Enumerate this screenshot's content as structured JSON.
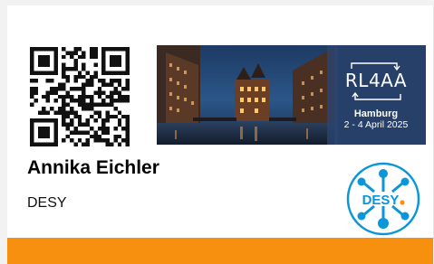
{
  "badge": {
    "name": "Annika Eichler",
    "organization": "DESY",
    "qr_code": "qr-code",
    "colors": {
      "stripe": "#f7900e",
      "desy_blue": "#0a96d8",
      "desy_dot": "#f7900e",
      "banner_sky": "#24466e"
    }
  },
  "event": {
    "logo_text": "RL4AA",
    "city": "Hamburg",
    "dates": "2 - 4 April 2025"
  },
  "desy_logo": {
    "text": "DESY"
  }
}
